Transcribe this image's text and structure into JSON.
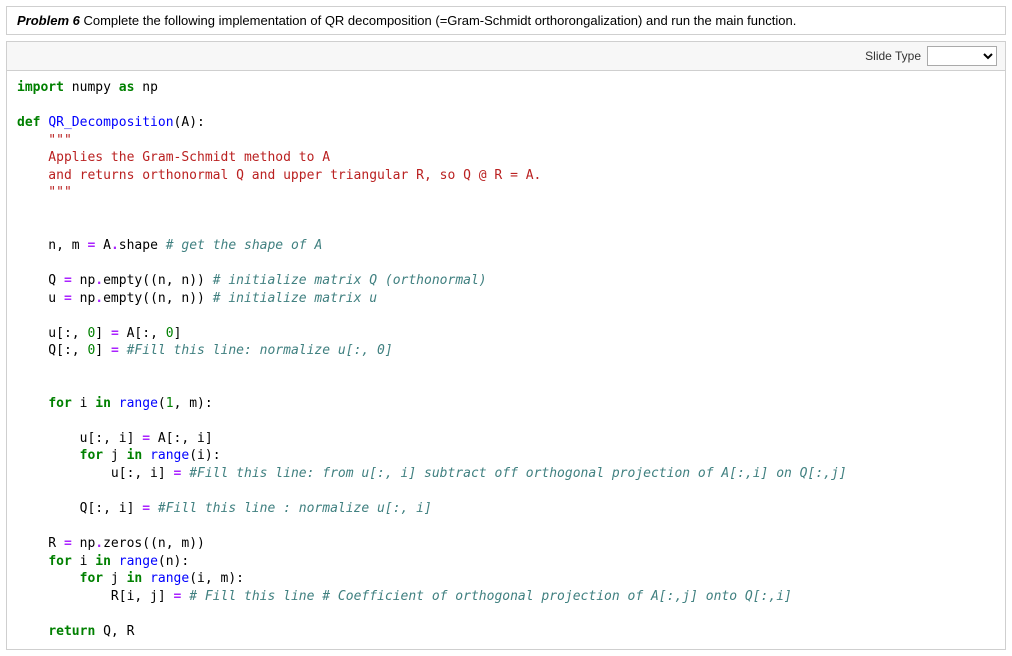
{
  "problem": {
    "title": "Problem 6",
    "text": " Complete the following implementation of QR decomposition (=Gram-Schmidt orthorongalization) and run the main function."
  },
  "toolbar": {
    "label": "Slide Type",
    "selected": ""
  },
  "code": {
    "l1_a": "import",
    "l1_b": " numpy ",
    "l1_c": "as",
    "l1_d": " np",
    "l3_a": "def",
    "l3_b": " ",
    "l3_c": "QR_Decomposition",
    "l3_d": "(A):",
    "l4": "    \"\"\"",
    "l5": "    Applies the Gram-Schmidt method to A",
    "l6": "    and returns orthonormal Q and upper triangular R, so Q @ R = A.",
    "l7": "    \"\"\"",
    "l10_a": "    n, m ",
    "l10_b": "=",
    "l10_c": " A",
    "l10_d": ".",
    "l10_e": "shape ",
    "l10_f": "# get the shape of A",
    "l12_a": "    Q ",
    "l12_b": "=",
    "l12_c": " np",
    "l12_d": ".",
    "l12_e": "empty((n, n)) ",
    "l12_f": "# initialize matrix Q (orthonormal)",
    "l13_a": "    u ",
    "l13_b": "=",
    "l13_c": " np",
    "l13_d": ".",
    "l13_e": "empty((n, n)) ",
    "l13_f": "# initialize matrix u",
    "l15_a": "    u[:, ",
    "l15_b": "0",
    "l15_c": "] ",
    "l15_d": "=",
    "l15_e": " A[:, ",
    "l15_f": "0",
    "l15_g": "]",
    "l16_a": "    Q[:, ",
    "l16_b": "0",
    "l16_c": "] ",
    "l16_d": "=",
    "l16_e": " ",
    "l16_f": "#Fill this line: normalize u[:, 0]",
    "l19_a": "    ",
    "l19_b": "for",
    "l19_c": " i ",
    "l19_d": "in",
    "l19_e": " ",
    "l19_f": "range",
    "l19_g": "(",
    "l19_h": "1",
    "l19_i": ", m):",
    "l21_a": "        u[:, i] ",
    "l21_b": "=",
    "l21_c": " A[:, i]",
    "l22_a": "        ",
    "l22_b": "for",
    "l22_c": " j ",
    "l22_d": "in",
    "l22_e": " ",
    "l22_f": "range",
    "l22_g": "(i):",
    "l23_a": "            u[:, i] ",
    "l23_b": "=",
    "l23_c": " ",
    "l23_d": "#Fill this line: from u[:, i] subtract off orthogonal projection of A[:,i] on Q[:,j]",
    "l25_a": "        Q[:, i] ",
    "l25_b": "=",
    "l25_c": " ",
    "l25_d": "#Fill this line : normalize u[:, i]",
    "l27_a": "    R ",
    "l27_b": "=",
    "l27_c": " np",
    "l27_d": ".",
    "l27_e": "zeros((n, m))",
    "l28_a": "    ",
    "l28_b": "for",
    "l28_c": " i ",
    "l28_d": "in",
    "l28_e": " ",
    "l28_f": "range",
    "l28_g": "(n):",
    "l29_a": "        ",
    "l29_b": "for",
    "l29_c": " j ",
    "l29_d": "in",
    "l29_e": " ",
    "l29_f": "range",
    "l29_g": "(i, m):",
    "l30_a": "            R[i, j] ",
    "l30_b": "=",
    "l30_c": " ",
    "l30_d": "# Fill this line # Coefficient of orthogonal projection of A[:,j] onto Q[:,i]",
    "l32_a": "    ",
    "l32_b": "return",
    "l32_c": " Q, R"
  }
}
